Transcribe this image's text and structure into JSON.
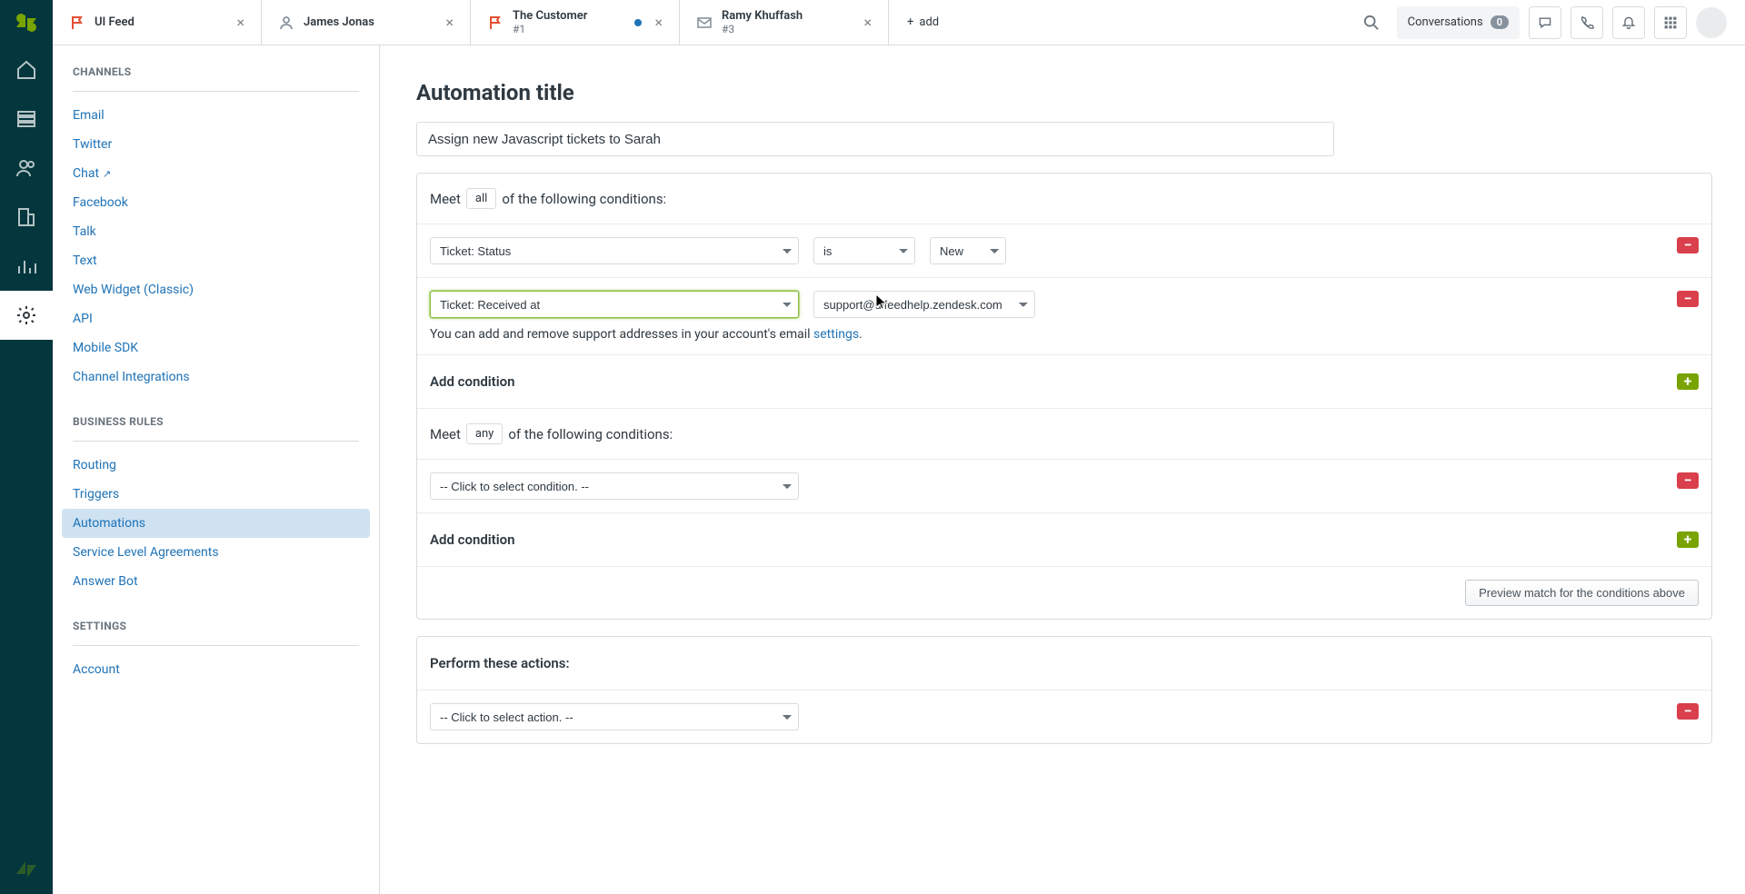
{
  "tabs": [
    {
      "title": "UI Feed",
      "sub": "",
      "icon": "flag"
    },
    {
      "title": "James Jonas",
      "sub": "",
      "icon": "user"
    },
    {
      "title": "The Customer",
      "sub": "#1",
      "icon": "flag",
      "dot": true
    },
    {
      "title": "Ramy Khuffash",
      "sub": "#3",
      "icon": "mail"
    }
  ],
  "add_tab_label": "add",
  "conversations": {
    "label": "Conversations",
    "count": "0"
  },
  "sidebar": {
    "sections": [
      {
        "title": "CHANNELS",
        "items": [
          {
            "label": "Email"
          },
          {
            "label": "Twitter"
          },
          {
            "label": "Chat",
            "external": true
          },
          {
            "label": "Facebook"
          },
          {
            "label": "Talk"
          },
          {
            "label": "Text"
          },
          {
            "label": "Web Widget (Classic)"
          },
          {
            "label": "API"
          },
          {
            "label": "Mobile SDK"
          },
          {
            "label": "Channel Integrations"
          }
        ]
      },
      {
        "title": "BUSINESS RULES",
        "items": [
          {
            "label": "Routing"
          },
          {
            "label": "Triggers"
          },
          {
            "label": "Automations",
            "active": true
          },
          {
            "label": "Service Level Agreements"
          },
          {
            "label": "Answer Bot"
          }
        ]
      },
      {
        "title": "SETTINGS",
        "items": [
          {
            "label": "Account"
          }
        ]
      }
    ]
  },
  "main": {
    "page_title": "Automation title",
    "title_value": "Assign new Javascript tickets to Sarah",
    "meet_label": "Meet",
    "of_following": "of the following conditions:",
    "all_chip": "all",
    "any_chip": "any",
    "conditions_all": [
      {
        "field": "Ticket: Status",
        "op": "is",
        "value": "New"
      },
      {
        "field": "Ticket: Received at",
        "email": "support@uifeedhelp.zendesk.com"
      }
    ],
    "help_text_prefix": "You can add and remove support addresses in your account's email ",
    "help_link": "settings",
    "help_text_suffix": ".",
    "add_condition_label": "Add condition",
    "conditions_any": [
      {
        "placeholder": "-- Click to select condition. --"
      }
    ],
    "preview_label": "Preview match for the conditions above",
    "perform_label": "Perform these actions:",
    "action_placeholder": "-- Click to select action. --"
  }
}
